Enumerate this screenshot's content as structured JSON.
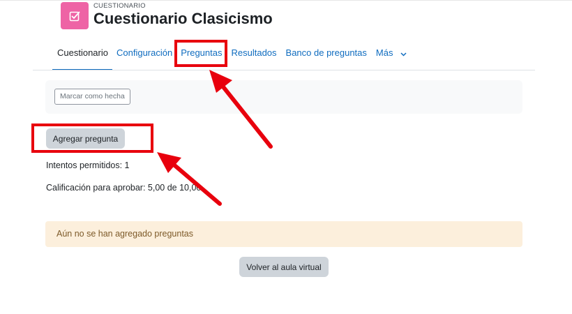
{
  "header": {
    "activity_label": "CUESTIONARIO",
    "title": "Cuestionario Clasicismo",
    "icon": "quiz-check-icon",
    "icon_color": "#ee63a5"
  },
  "nav": {
    "tabs": [
      {
        "label": "Cuestionario",
        "active": true
      },
      {
        "label": "Configuración"
      },
      {
        "label": "Preguntas"
      },
      {
        "label": "Resultados"
      },
      {
        "label": "Banco de preguntas"
      },
      {
        "label": "Más"
      }
    ]
  },
  "completion": {
    "mark_label": "Marcar como hecha"
  },
  "actions": {
    "add_question_label": "Agregar pregunta",
    "back_label": "Volver al aula virtual"
  },
  "info": {
    "attempts": "Intentos permitidos: 1",
    "grade_to_pass": "Calificación para aprobar: 5,00 de 10,00"
  },
  "alert": {
    "message": "Aún no se han agregado preguntas"
  },
  "annotations": {
    "highlight_color": "#e8000d"
  }
}
